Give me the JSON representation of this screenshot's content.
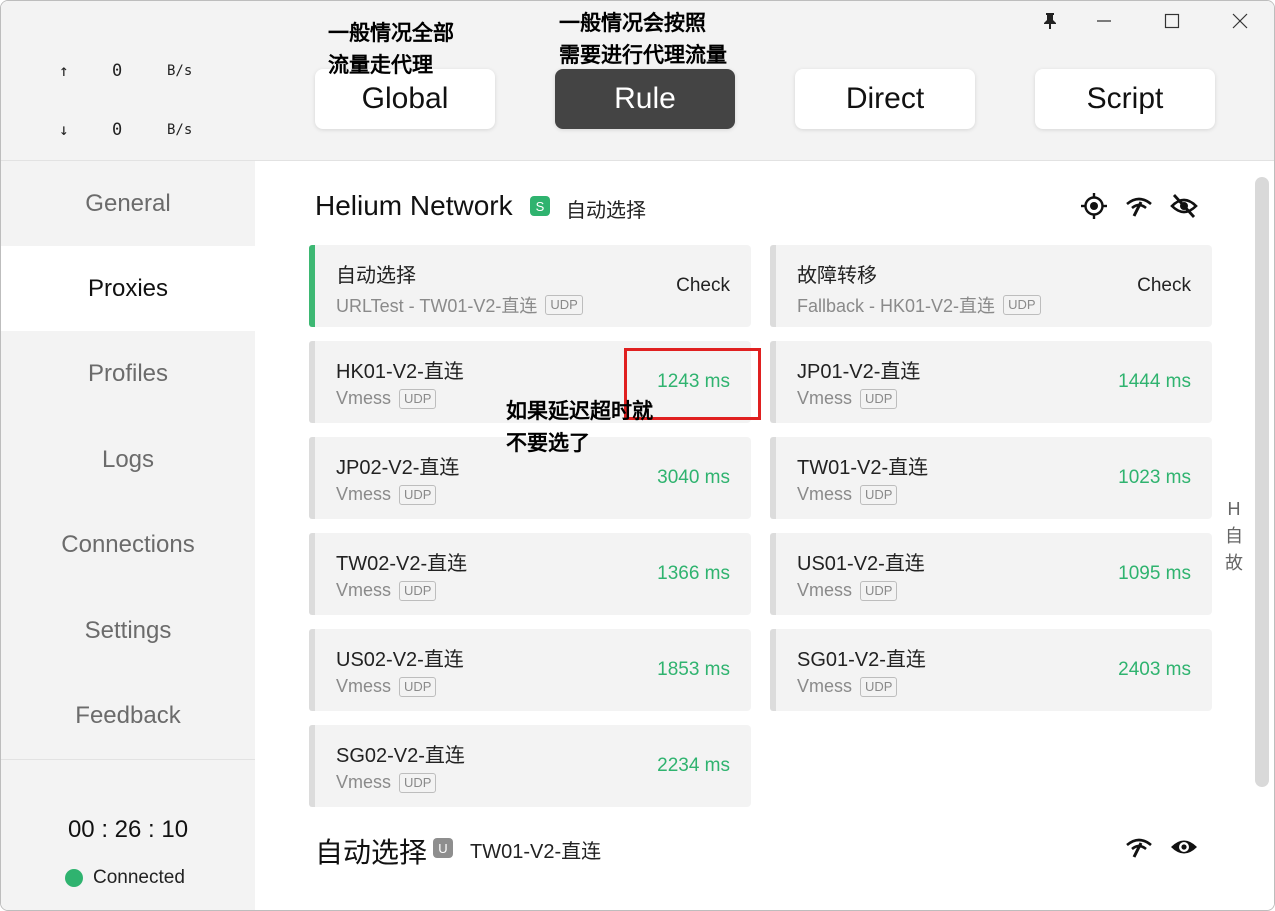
{
  "window": {
    "controls": [
      "pin",
      "minimize",
      "maximize",
      "close"
    ]
  },
  "traffic": {
    "up_arrow": "↑",
    "up_value": "0",
    "up_unit": "B/s",
    "down_arrow": "↓",
    "down_value": "0",
    "down_unit": "B/s"
  },
  "sidebar": {
    "items": [
      {
        "label": "General",
        "active": false
      },
      {
        "label": "Proxies",
        "active": true
      },
      {
        "label": "Profiles",
        "active": false
      },
      {
        "label": "Logs",
        "active": false
      },
      {
        "label": "Connections",
        "active": false
      },
      {
        "label": "Settings",
        "active": false
      },
      {
        "label": "Feedback",
        "active": false
      }
    ],
    "clock": "00 : 26 : 10",
    "status": "Connected",
    "status_color": "#2fb36f"
  },
  "modes": {
    "items": [
      {
        "label": "Global",
        "active": false
      },
      {
        "label": "Rule",
        "active": true
      },
      {
        "label": "Direct",
        "active": false
      },
      {
        "label": "Script",
        "active": false
      }
    ]
  },
  "group1": {
    "title": "Helium Network",
    "badge": "S",
    "current": "自动选择",
    "icons": [
      "locate-icon",
      "speed-test-icon",
      "eye-off-icon"
    ]
  },
  "cards": [
    {
      "name": "自动选择",
      "sub": "URLTest - TW01-V2-直连",
      "udp": "UDP",
      "action": "Check",
      "selected": true
    },
    {
      "name": "故障转移",
      "sub": "Fallback - HK01-V2-直连",
      "udp": "UDP",
      "action": "Check",
      "selected": false
    },
    {
      "name": "HK01-V2-直连",
      "sub": "Vmess",
      "udp": "UDP",
      "delay": "1243 ms"
    },
    {
      "name": "JP01-V2-直连",
      "sub": "Vmess",
      "udp": "UDP",
      "delay": "1444 ms"
    },
    {
      "name": "JP02-V2-直连",
      "sub": "Vmess",
      "udp": "UDP",
      "delay": "3040 ms"
    },
    {
      "name": "TW01-V2-直连",
      "sub": "Vmess",
      "udp": "UDP",
      "delay": "1023 ms"
    },
    {
      "name": "TW02-V2-直连",
      "sub": "Vmess",
      "udp": "UDP",
      "delay": "1366 ms"
    },
    {
      "name": "US01-V2-直连",
      "sub": "Vmess",
      "udp": "UDP",
      "delay": "1095 ms"
    },
    {
      "name": "US02-V2-直连",
      "sub": "Vmess",
      "udp": "UDP",
      "delay": "1853 ms"
    },
    {
      "name": "SG01-V2-直连",
      "sub": "Vmess",
      "udp": "UDP",
      "delay": "2403 ms"
    },
    {
      "name": "SG02-V2-直连",
      "sub": "Vmess",
      "udp": "UDP",
      "delay": "2234 ms"
    }
  ],
  "group2": {
    "title": "自动选择",
    "badge": "U",
    "current": "TW01-V2-直连",
    "icons": [
      "speed-test-icon",
      "eye-icon"
    ]
  },
  "side_index": [
    "H",
    "自",
    "故"
  ],
  "annotations": {
    "global_note": [
      "一般情况全部",
      "流量走代理"
    ],
    "rule_note": [
      "一般情况会按照",
      "需要进行代理流量"
    ],
    "delay_note": [
      "如果延迟超时就",
      "不要选了"
    ]
  }
}
